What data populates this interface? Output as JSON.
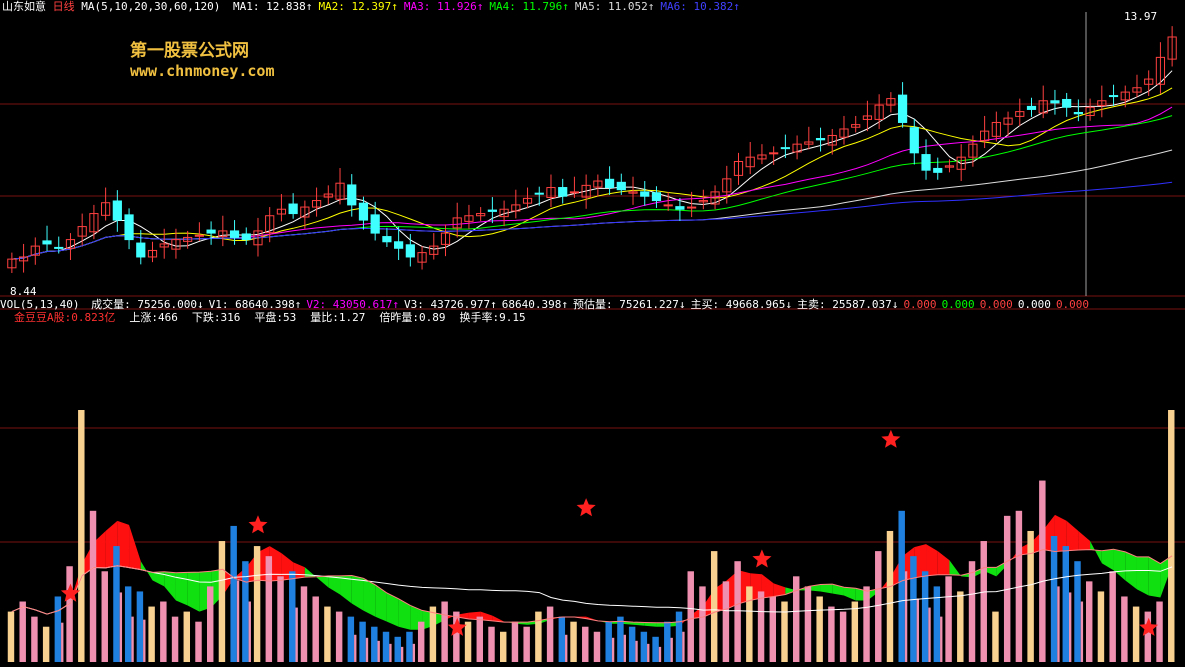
{
  "price_panel": {
    "stock_name": "山东如意",
    "period": "日线",
    "ma_params": "MA(5,10,20,30,60,120)",
    "ma_values": [
      {
        "label": "MA1: 12.838↑",
        "color": "#ffffff"
      },
      {
        "label": "MA2: 12.397↑",
        "color": "#ffff00"
      },
      {
        "label": "MA3: 11.926↑",
        "color": "#ff00ff"
      },
      {
        "label": "MA4: 11.796↑",
        "color": "#00ff00"
      },
      {
        "label": "MA5: 11.052↑",
        "color": "#dddddd"
      },
      {
        "label": "MA6: 10.382↑",
        "color": "#4040ff"
      }
    ],
    "price_high_label": "13.97",
    "price_low_label": "8.44",
    "watermark_title": "第一股票公式网",
    "watermark_url": "www.chnmoney.com"
  },
  "volume_panel": {
    "params": "VOL(5,13,40)",
    "stats": [
      {
        "label": "成交量: 75256.000↓",
        "color": "#ffffff"
      },
      {
        "label": "V1: 68640.398↑",
        "color": "#ffffff"
      },
      {
        "label": "V2: 43050.617↑",
        "color": "#ff00ff"
      },
      {
        "label": "V3: 43726.977↑",
        "color": "#ffffff"
      },
      {
        "label": "68640.398↑",
        "color": "#ffffff"
      },
      {
        "label": "预估量: 75261.227↓",
        "color": "#ffffff"
      },
      {
        "label": "主买: 49668.965↓",
        "color": "#ffffff"
      },
      {
        "label": "主卖: 25587.037↓",
        "color": "#ffffff"
      },
      {
        "label": "0.000",
        "color": "#ff4040"
      },
      {
        "label": "0.000",
        "color": "#00ff00"
      },
      {
        "label": "0.000",
        "color": "#ff4040"
      },
      {
        "label": "0.000",
        "color": "#ffffff"
      },
      {
        "label": "0.000",
        "color": "#ff4040"
      }
    ],
    "line2": [
      {
        "label": "金豆豆A股:0.823亿",
        "color": "#ff3030"
      },
      {
        "label": "上涨:466",
        "color": "#ffffff"
      },
      {
        "label": "下跌:316",
        "color": "#ffffff"
      },
      {
        "label": "平盘:53",
        "color": "#ffffff"
      },
      {
        "label": "量比:1.27",
        "color": "#ffffff"
      },
      {
        "label": "倍昨量:0.89",
        "color": "#ffffff"
      },
      {
        "label": "换手率:9.15",
        "color": "#ffffff"
      }
    ]
  },
  "chart_data": [
    {
      "type": "candlestick",
      "x_count": 100,
      "ylim": [
        8.0,
        14.5
      ],
      "y_labels": [
        "13.97",
        "8.44"
      ],
      "series_colors": {
        "up": "#ff4040",
        "down": "#40ffff"
      },
      "closes": [
        8.85,
        8.9,
        9.15,
        9.2,
        9.1,
        9.3,
        9.6,
        9.9,
        10.15,
        9.75,
        9.3,
        8.9,
        9.05,
        9.2,
        9.3,
        9.35,
        9.4,
        9.45,
        9.5,
        9.35,
        9.3,
        9.5,
        9.85,
        10.0,
        9.9,
        10.05,
        10.2,
        10.35,
        10.6,
        10.1,
        9.75,
        9.45,
        9.25,
        9.1,
        8.9,
        9.0,
        9.15,
        9.45,
        9.8,
        9.85,
        9.9,
        9.95,
        10.0,
        10.1,
        10.25,
        10.35,
        10.5,
        10.3,
        10.4,
        10.55,
        10.65,
        10.5,
        10.45,
        10.4,
        10.3,
        10.2,
        10.1,
        10.0,
        10.05,
        10.2,
        10.4,
        10.7,
        11.1,
        11.2,
        11.25,
        11.3,
        11.4,
        11.5,
        11.55,
        11.6,
        11.7,
        11.85,
        11.95,
        12.15,
        12.4,
        12.55,
        12.0,
        11.3,
        10.9,
        10.85,
        11.0,
        11.2,
        11.5,
        11.8,
        12.0,
        12.1,
        12.25,
        12.3,
        12.5,
        12.45,
        12.35,
        12.2,
        12.35,
        12.5,
        12.6,
        12.7,
        12.8,
        13.0,
        13.5,
        13.97
      ]
    },
    {
      "type": "bar",
      "x_count": 100,
      "series_colors": {
        "bar": "#f090b0",
        "up_alt": "#f8d090",
        "down": "#2080e0"
      },
      "values": [
        20,
        24,
        18,
        14,
        26,
        38,
        100,
        60,
        36,
        46,
        30,
        28,
        22,
        24,
        18,
        20,
        16,
        30,
        48,
        54,
        40,
        46,
        42,
        34,
        36,
        30,
        26,
        22,
        20,
        18,
        16,
        14,
        12,
        10,
        12,
        16,
        22,
        24,
        20,
        16,
        18,
        14,
        12,
        16,
        14,
        20,
        22,
        18,
        16,
        14,
        12,
        16,
        18,
        14,
        12,
        10,
        16,
        20,
        36,
        30,
        44,
        32,
        40,
        30,
        28,
        26,
        24,
        34,
        30,
        26,
        22,
        20,
        24,
        30,
        44,
        52,
        60,
        42,
        36,
        30,
        34,
        28,
        40,
        48,
        20,
        58,
        60,
        52,
        72,
        50,
        46,
        40,
        32,
        28,
        36,
        26,
        22,
        20,
        24,
        100
      ]
    }
  ]
}
